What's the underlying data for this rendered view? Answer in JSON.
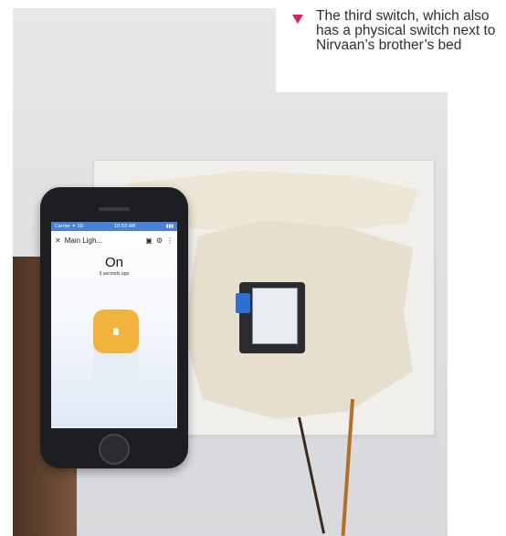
{
  "caption": {
    "text": "The third switch, which also has a physical switch next to Nirvaan’s brother’s bed",
    "marker_color": "#e21e5a"
  },
  "phone": {
    "status_left": "Carrier ✦ 3G",
    "status_time": "10:53 AM",
    "status_right": "▮▮▮",
    "app_title": "Main Ligh...",
    "icons": [
      "close-icon",
      "box-icon",
      "gear-icon",
      "more-icon"
    ],
    "state_label": "On",
    "state_time": "6 seconds ago",
    "toggle_on_color": "#f2b33d"
  }
}
